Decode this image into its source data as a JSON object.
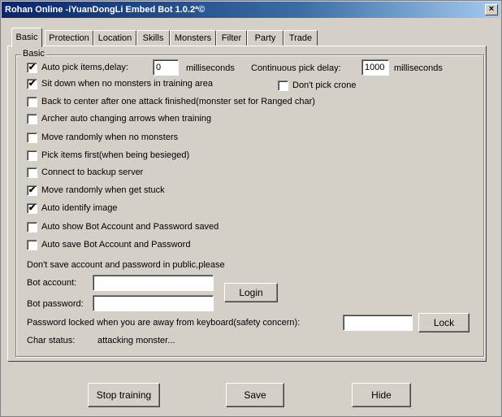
{
  "window": {
    "title": "Rohan Online -iYuanDongLi Embed Bot 1.0.2ª©",
    "close_label": "×"
  },
  "tabs": [
    "Basic",
    "Protection",
    "Location",
    "Skills",
    "Monsters",
    "Filter",
    "Party",
    "Trade"
  ],
  "group": {
    "label": "Basic"
  },
  "options": {
    "auto_pick": {
      "label": "Auto pick items,delay:",
      "checked": true,
      "delay_value": "0",
      "unit": "milliseconds"
    },
    "continuous": {
      "label": "Continuous pick delay:",
      "value": "1000",
      "unit": "milliseconds"
    },
    "sit_down": {
      "label": "Sit down when no monsters in training area",
      "checked": true
    },
    "dont_pick_crone": {
      "label": "Don't pick crone",
      "checked": false
    },
    "back_to_center": {
      "label": "Back to center after one attack finished(monster set for Ranged char)",
      "checked": false
    },
    "archer_arrows": {
      "label": "Archer auto changing arrows when training",
      "checked": false
    },
    "move_randomly_none": {
      "label": "Move randomly when no monsters",
      "checked": false
    },
    "pick_first": {
      "label": "Pick items first(when being besieged)",
      "checked": false
    },
    "backup_server": {
      "label": "Connect to backup server",
      "checked": false
    },
    "move_stuck": {
      "label": "Move randomly when get stuck",
      "checked": true
    },
    "identify_image": {
      "label": "Auto identify image",
      "checked": true
    },
    "show_account": {
      "label": "Auto show Bot Account and Password saved",
      "checked": false
    },
    "save_account": {
      "label": "Auto save Bot Account and Password",
      "checked": false
    }
  },
  "account": {
    "warning": "Don't save account and password in public,please",
    "account_label": "Bot account:",
    "account_value": "",
    "password_label": "Bot password:",
    "password_value": "",
    "login_label": "Login",
    "lock_text": "Password locked when you are away from keyboard(safety concern):",
    "lock_value": "",
    "lock_label": "Lock"
  },
  "status": {
    "label": "Char status:",
    "value": "attacking monster..."
  },
  "footer": {
    "stop_label": "Stop training",
    "save_label": "Save",
    "hide_label": "Hide"
  },
  "check_glyph": "✔"
}
